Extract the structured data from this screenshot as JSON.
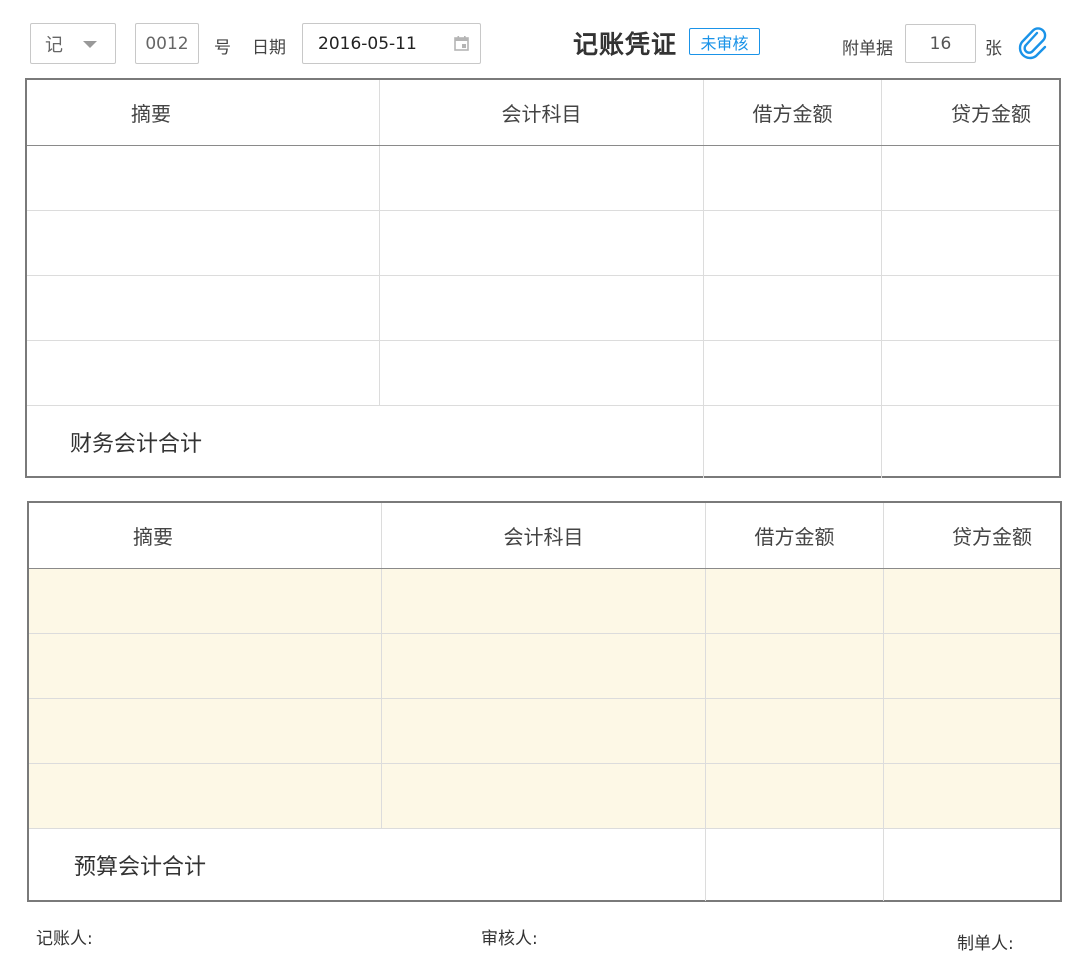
{
  "header": {
    "voucher_type": "记",
    "voucher_number": "0012",
    "number_suffix": "号",
    "date_label": "日期",
    "date_value": "2016-05-11",
    "title": "记账凭证",
    "status_badge": "未审核",
    "attachment_label": "附单据",
    "attachment_count": "16",
    "attachment_unit": "张",
    "accent_color": "#1a93e8"
  },
  "columns": [
    "摘要",
    "会计科目",
    "借方金额",
    "贷方金额"
  ],
  "financial_section": {
    "rows": 4,
    "total_label": "财务会计合计"
  },
  "budget_section": {
    "rows": 4,
    "row_background": "#fdf8e6",
    "total_label": "预算会计合计"
  },
  "footer": {
    "bookkeeper_label": "记账人:",
    "reviewer_label": "审核人:",
    "preparer_label": "制单人:"
  }
}
